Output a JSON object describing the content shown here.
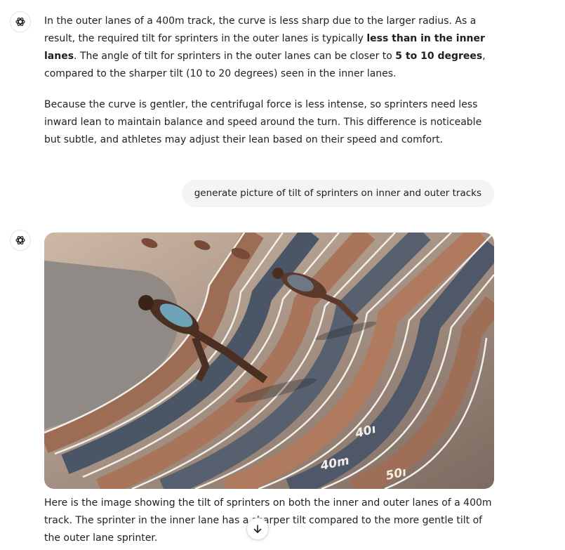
{
  "messages": {
    "assistant_1": {
      "p1_a": "In the outer lanes of a 400m track, the curve is less sharp due to the larger radius. As a result, the required tilt for sprinters in the outer lanes is typically ",
      "p1_b": "less than in the inner lanes",
      "p1_c": ". The angle of tilt for sprinters in the outer lanes can be closer to ",
      "p1_d": "5 to 10 degrees",
      "p1_e": ", compared to the sharper tilt (10 to 20 degrees) seen in the inner lanes.",
      "p2": "Because the curve is gentler, the centrifugal force is less intense, so sprinters need less inward lean to maintain balance and speed around the turn. This difference is noticeable but subtle, and athletes may adjust their lean based on their speed and comfort."
    },
    "user_1": "generate picture of tilt of sprinters on inner and outer tracks",
    "assistant_2": {
      "image_marks": [
        "40m",
        "40ı",
        "50ı"
      ],
      "caption": "Here is the image showing the tilt of sprinters on both the inner and outer lanes of a 400m track. The sprinter in the inner lane has a sharper tilt compared to the more gentle tilt of the outer lane sprinter."
    }
  },
  "icons": {
    "assistant_avatar": "openai-logo-icon",
    "scroll_down": "arrow-down-icon"
  },
  "colors": {
    "text": "#1f1f1f",
    "user_bubble": "#f4f4f4",
    "track_red": "#a8745a",
    "track_blue": "#4a5566",
    "infield": "#8f8a85"
  }
}
